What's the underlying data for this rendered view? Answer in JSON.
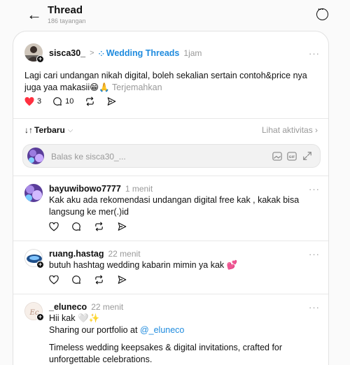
{
  "header": {
    "title": "Thread",
    "views": "186 tayangan"
  },
  "post": {
    "username": "sisca30_",
    "separator": ">",
    "community": "Wedding Threads",
    "time": "1jam",
    "text": "Lagi cari undangan nikah digital, boleh sekalian sertain contoh&price nya juga yaa makasii😁🙏",
    "translate": "Terjemahkan",
    "likes": "3",
    "comments": "10"
  },
  "sort": {
    "label": "Terbaru",
    "activity": "Lihat aktivitas"
  },
  "reply_input": {
    "placeholder": "Balas ke sisca30_..."
  },
  "replies": [
    {
      "username": "bayuwibowo7777",
      "time": "1 menit",
      "text": "Kak aku ada rekomendasi undangan digital free kak , kakak bisa langsung ke mer(.)id"
    },
    {
      "username": "ruang.hastag",
      "time": "22 menit",
      "text": "butuh hashtag wedding kabarin mimin ya kak 💕"
    },
    {
      "username": "_eluneco",
      "time": "22 menit",
      "line1": "Hii kak 🤍✨",
      "line2_prefix": "Sharing our portfolio at",
      "line2_link": "@_eluneco",
      "line3": "Timeless wedding keepsakes & digital invitations, crafted for unforgettable celebrations."
    }
  ]
}
